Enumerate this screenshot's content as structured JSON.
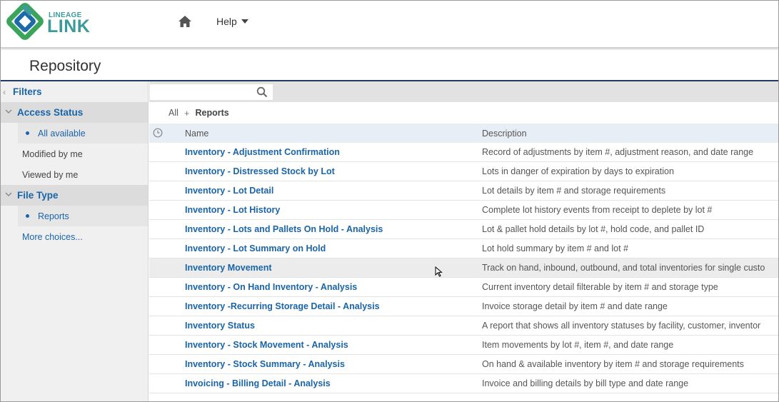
{
  "brand": {
    "logo_small": "LINEAGE",
    "logo_big": "LINK",
    "colors": {
      "green": "#3aa55a",
      "teal": "#3d9a9b",
      "blue": "#1d6aa8",
      "navy": "#1f3b63",
      "link": "#1a64a8"
    }
  },
  "nav": {
    "home_icon": "home-icon",
    "help_label": "Help"
  },
  "page": {
    "title": "Repository"
  },
  "sidebar": {
    "filters_label": "Filters",
    "sections": [
      {
        "label": "Access Status",
        "items": [
          {
            "label": "All available",
            "selected": true
          },
          {
            "label": "Modified by me",
            "selected": false
          },
          {
            "label": "Viewed by me",
            "selected": false
          }
        ]
      },
      {
        "label": "File Type",
        "items": [
          {
            "label": "Reports",
            "selected": true
          }
        ],
        "more_label": "More choices..."
      }
    ]
  },
  "search": {
    "placeholder": ""
  },
  "breadcrumb": {
    "root": "All",
    "current": "Reports"
  },
  "table": {
    "columns": {
      "name": "Name",
      "description": "Description"
    },
    "rows": [
      {
        "name": "Inventory - Adjustment Confirmation",
        "description": "Record of adjustments by item #, adjustment reason, and date range"
      },
      {
        "name": "Inventory - Distressed Stock by Lot",
        "description": "Lots in danger of expiration by days to expiration"
      },
      {
        "name": "Inventory - Lot Detail",
        "description": "Lot details by item # and storage requirements"
      },
      {
        "name": "Inventory - Lot History",
        "description": "Complete lot history events from receipt to deplete by lot #"
      },
      {
        "name": "Inventory - Lots and Pallets On Hold - Analysis",
        "description": "Lot & pallet hold details by lot #, hold code, and pallet ID"
      },
      {
        "name": "Inventory - Lot Summary on Hold",
        "description": "Lot hold summary by item # and lot #"
      },
      {
        "name": "Inventory Movement",
        "description": "Track on hand, inbound, outbound, and total inventories for single custo"
      },
      {
        "name": "Inventory - On Hand Inventory - Analysis",
        "description": "Current inventory detail filterable by item # and storage type"
      },
      {
        "name": "Inventory -Recurring Storage Detail - Analysis",
        "description": "Invoice storage detail by item # and date range"
      },
      {
        "name": "Inventory Status",
        "description": "A report that shows all inventory statuses by facility, customer, inventor"
      },
      {
        "name": "Inventory - Stock Movement - Analysis",
        "description": "Item movements by lot #, item #, and date range"
      },
      {
        "name": "Inventory - Stock Summary - Analysis",
        "description": "On hand & available inventory by item # and storage requirements"
      },
      {
        "name": "Invoicing - Billing Detail - Analysis",
        "description": "Invoice and billing details by bill type and date range"
      }
    ]
  }
}
